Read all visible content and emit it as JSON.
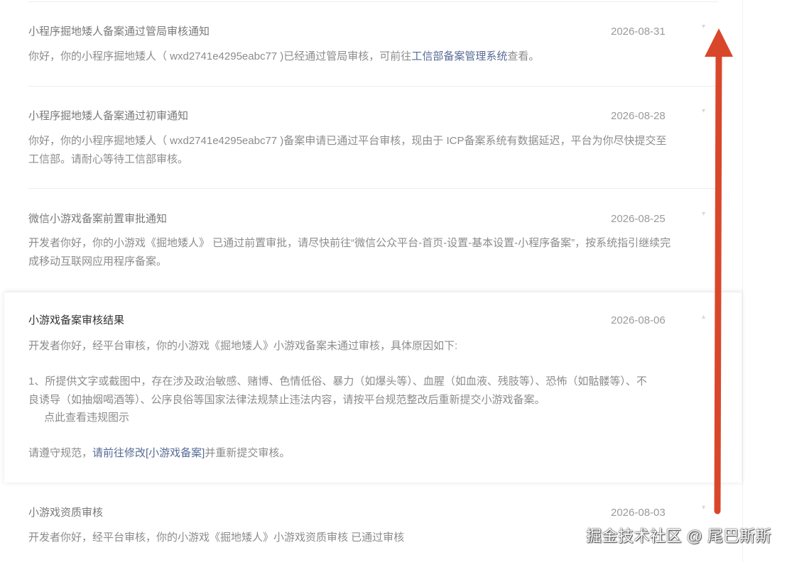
{
  "colors": {
    "link": "#576b95",
    "arrow": "#d9472b",
    "divider": "#eeeeee"
  },
  "notices": [
    {
      "title": "小程序掘地矮人备案通过管局审核通知",
      "date": "2026-08-31",
      "body_prefix": "你好，你的小程序掘地矮人（ wxd2741e4295eabc77 )已经通过管局审核，可前往",
      "body_link": "工信部备案管理系统",
      "body_suffix": "查看。"
    },
    {
      "title": "小程序掘地矮人备案通过初审通知",
      "date": "2026-08-28",
      "body": "你好，你的小程序掘地矮人（ wxd2741e4295eabc77 )备案申请已通过平台审核，现由于 ICP备案系统有数据延迟，平台为你尽快提交至工信部。请耐心等待工信部审核。"
    },
    {
      "title": "微信小游戏备案前置审批通知",
      "date": "2026-08-25",
      "body": "开发者你好，你的小游戏《掘地矮人》 已通过前置审批，请尽快前往“微信公众平台-首页-设置-基本设置-小程序备案”，按系统指引继续完成移动互联网应用程序备案。"
    },
    {
      "title": "小游戏资质审核",
      "date": "2026-08-03",
      "body": "开发者你好，经平台审核，你的小游戏《掘地矮人》小游戏资质审核 已通过审核"
    }
  ],
  "expanded_notice": {
    "title": "小游戏备案审核结果",
    "date": "2026-08-06",
    "line1": "开发者你好，经平台审核，你的小游戏《掘地矮人》小游戏备案未通过审核，具体原因如下:",
    "reason": "1、所提供文字或截图中，存在涉及政治敏感、赌博、色情低俗、暴力（如爆头等）、血腥（如血液、残肢等）、恐怖（如骷髅等）、不良诱导（如抽烟喝酒等）、公序良俗等国家法律法规禁止违法内容，请按平台规范整改后重新提交小游戏备案。",
    "violation_link": "点此查看违规图示",
    "footer_prefix": "请遵守规范，",
    "footer_link": "请前往修改[小游戏备案]",
    "footer_suffix": "并重新提交审核。"
  },
  "watermark": "掘金技术社区 @ 尾巴斯斯"
}
